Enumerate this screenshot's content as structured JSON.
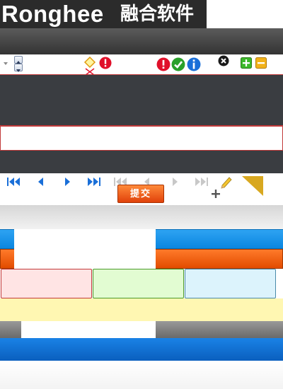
{
  "logo": {
    "wordmark": "Ronghee",
    "chinese": "融合软件"
  },
  "toolbar_icons": [
    "sort-arrow-icon",
    "stepper-icon",
    "diamond-icon",
    "error-icon",
    "error-icon",
    "check-icon",
    "info-icon",
    "close-icon",
    "plus-icon",
    "minus-icon"
  ],
  "pager": {
    "submit_label": "提交",
    "icons": [
      "first-page-icon",
      "prev-page-icon",
      "next-page-icon",
      "last-page-icon",
      "first-page-disabled-icon",
      "prev-page-disabled-icon",
      "next-page-disabled-icon",
      "last-page-disabled-icon",
      "pencil-icon",
      "add-icon"
    ]
  },
  "colors": {
    "error": "#e0102a",
    "success": "#2aa02a",
    "info": "#1a6fd8",
    "accent_blue": "#1a8fe8",
    "accent_orange": "#f26a1a",
    "dark_bar": "#3a3d41",
    "yellow_band": "#fff7b2",
    "red_cell": "#ffe4e4",
    "green_cell": "#e2fcd2",
    "cyan_cell": "#dcf3fc"
  }
}
